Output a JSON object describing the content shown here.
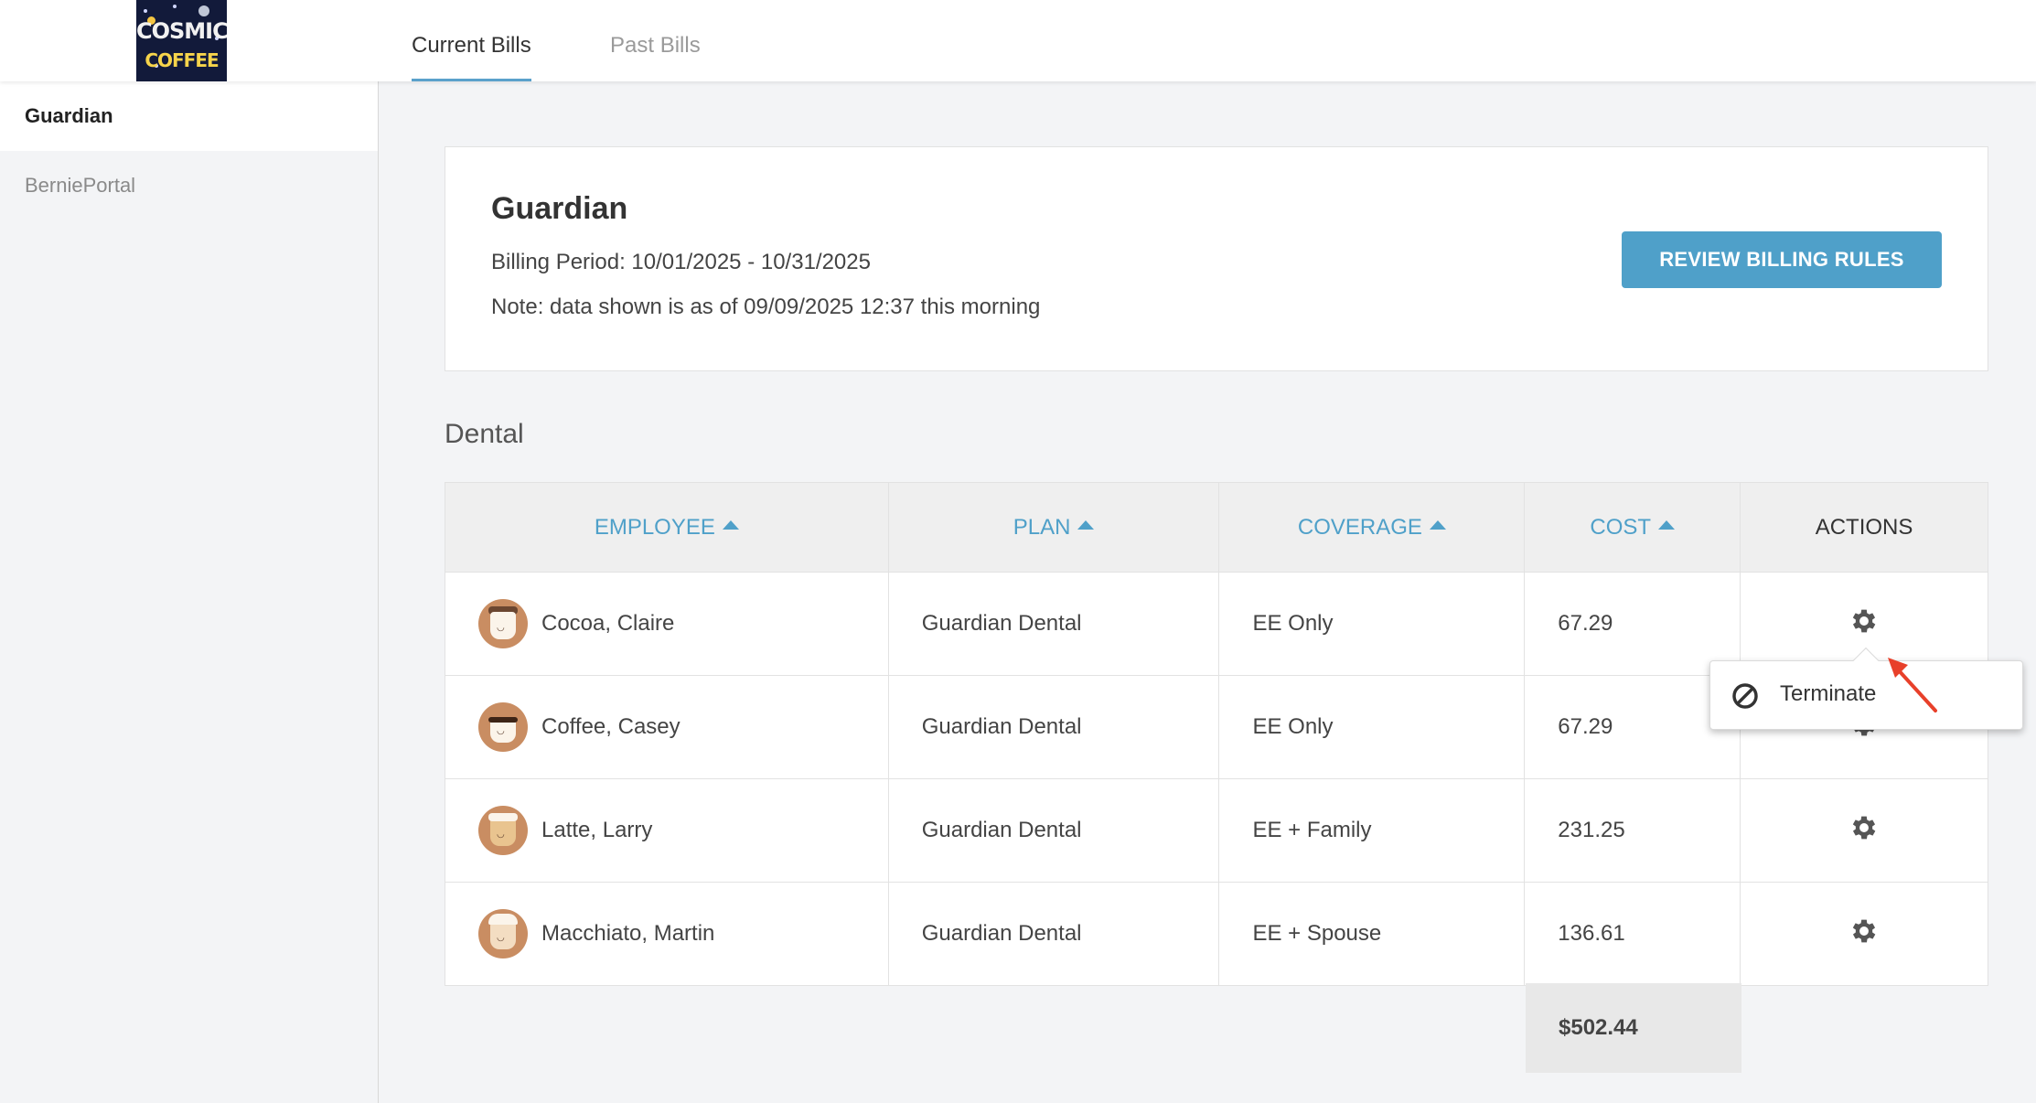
{
  "logo": {
    "line1": "COSMIC",
    "line2": "COFFEE"
  },
  "tabs": [
    {
      "label": "Current Bills",
      "active": true
    },
    {
      "label": "Past Bills",
      "active": false
    }
  ],
  "sidebar": {
    "items": [
      {
        "label": "Guardian",
        "active": true
      },
      {
        "label": "BerniePortal",
        "active": false
      }
    ]
  },
  "header": {
    "title": "Guardian",
    "billing_period": "Billing Period: 10/01/2025 - 10/31/2025",
    "note": "Note: data shown is as of 09/09/2025 12:37 this morning",
    "review_button": "REVIEW BILLING RULES"
  },
  "section_title": "Dental",
  "table": {
    "columns": [
      "EMPLOYEE",
      "PLAN",
      "COVERAGE",
      "COST",
      "ACTIONS"
    ],
    "rows": [
      {
        "employee": "Cocoa, Claire",
        "plan": "Guardian Dental",
        "coverage": "EE Only",
        "cost": "67.29",
        "avatar": "cocoa-cup-icon"
      },
      {
        "employee": "Coffee, Casey",
        "plan": "Guardian Dental",
        "coverage": "EE Only",
        "cost": "67.29",
        "avatar": "coffee-cup-icon"
      },
      {
        "employee": "Latte, Larry",
        "plan": "Guardian Dental",
        "coverage": "EE + Family",
        "cost": "231.25",
        "avatar": "latte-glass-icon"
      },
      {
        "employee": "Macchiato, Martin",
        "plan": "Guardian Dental",
        "coverage": "EE + Spouse",
        "cost": "136.61",
        "avatar": "macchiato-cup-icon"
      }
    ],
    "total": "$502.44"
  },
  "dropdown": {
    "terminate_label": "Terminate"
  },
  "colors": {
    "accent": "#4fa0c9",
    "annotation_arrow": "#e8402a"
  }
}
